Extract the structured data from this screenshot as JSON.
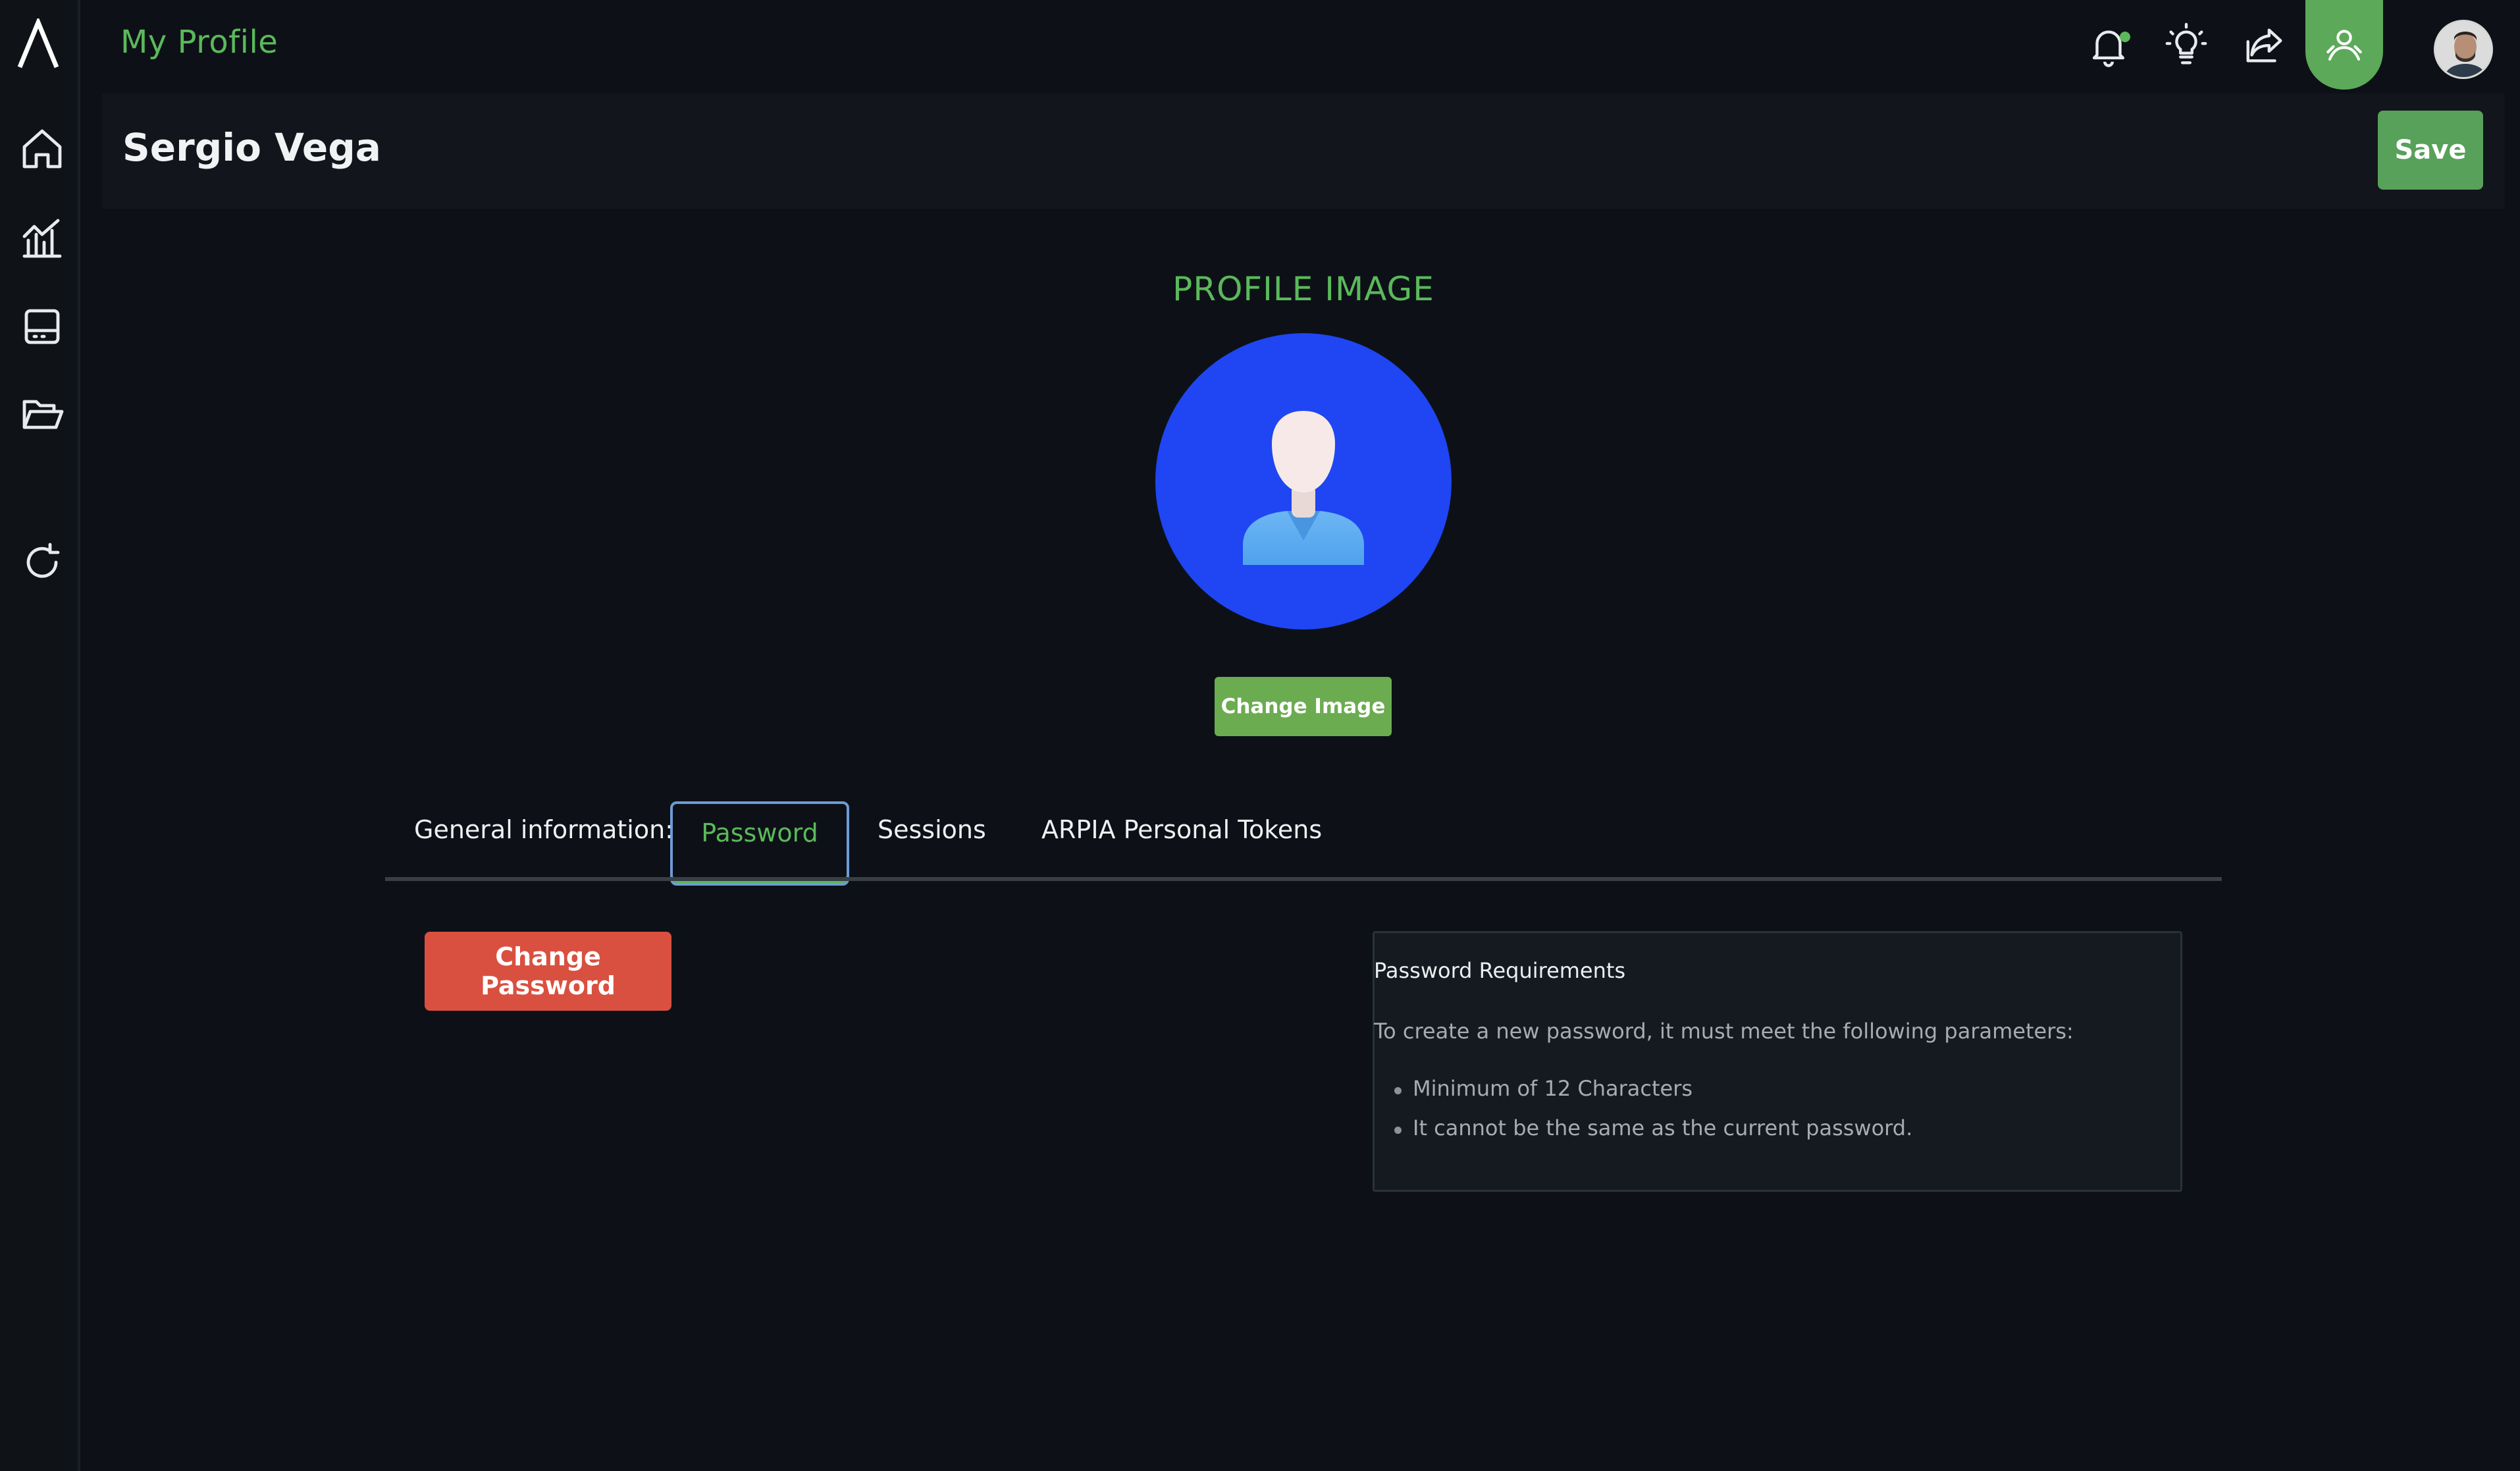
{
  "app": {
    "title": "My Profile"
  },
  "sidebar": {
    "items": [
      {
        "icon": "home-icon"
      },
      {
        "icon": "analytics-icon"
      },
      {
        "icon": "dashboard-icon"
      },
      {
        "icon": "folder-icon"
      },
      {
        "icon": "refresh-icon"
      }
    ]
  },
  "topbar": {
    "icons": [
      "bell-icon",
      "lightbulb-icon",
      "share-icon",
      "user-profile-icon"
    ],
    "notification_dot_color": "#5bb95b"
  },
  "header": {
    "name": "Sergio Vega",
    "save_label": "Save"
  },
  "profile_image": {
    "title": "PROFILE IMAGE",
    "change_label": "Change Image"
  },
  "tabs": [
    {
      "label": "General information:",
      "active": false
    },
    {
      "label": "Password",
      "active": true
    },
    {
      "label": "Sessions",
      "active": false
    },
    {
      "label": "ARPIA Personal Tokens",
      "active": false
    }
  ],
  "password": {
    "change_label": "Change Password",
    "requirements": {
      "title": "Password Requirements",
      "description": "To create a new password, it must meet the following parameters:",
      "items": [
        "Minimum of 12 Characters",
        "It cannot be the same as the current password."
      ]
    }
  },
  "colors": {
    "accent": "#5bb95b",
    "danger": "#d95040",
    "profile_bg": "#1f46f2",
    "background": "#0d1117"
  }
}
